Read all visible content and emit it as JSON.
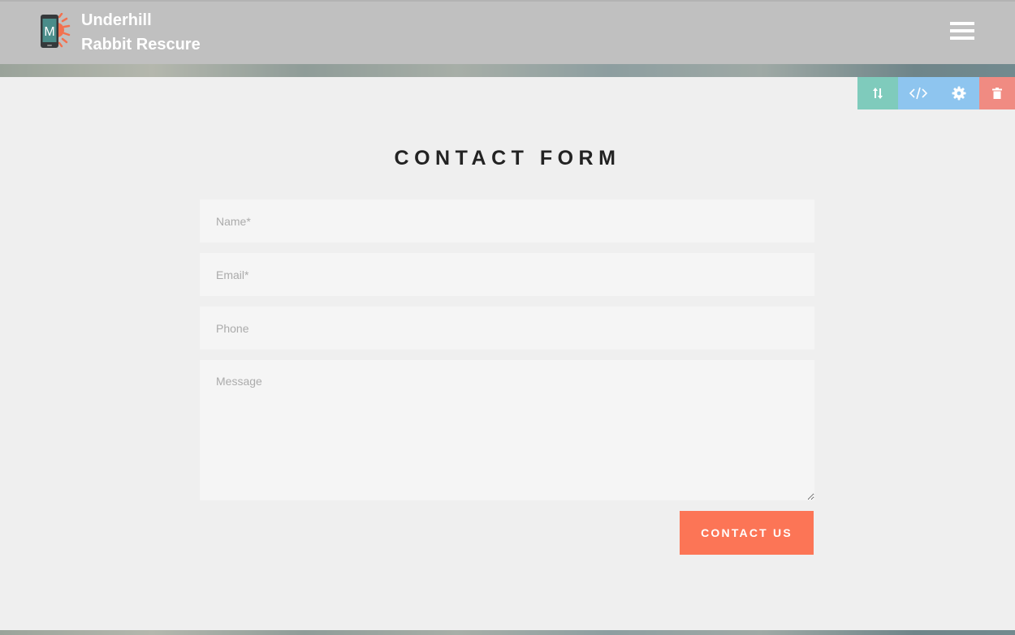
{
  "header": {
    "logo_letter": "M",
    "brand_line1": "Underhill",
    "brand_line2": "Rabbit Rescure",
    "menu_icon": "hamburger-menu-icon"
  },
  "toolbar": {
    "icons": [
      "sort-arrows-icon",
      "code-icon",
      "gear-icon",
      "trash-icon"
    ],
    "colors": {
      "move": "#7fcbbc",
      "code": "#8ec5ef",
      "settings": "#8ec5ef",
      "delete": "#f08b82"
    }
  },
  "form": {
    "title": "CONTACT FORM",
    "name_placeholder": "Name*",
    "email_placeholder": "Email*",
    "phone_placeholder": "Phone",
    "message_placeholder": "Message",
    "submit_label": "CONTACT US"
  },
  "colors": {
    "header_bg": "#c0c0c0",
    "section_bg": "#efefef",
    "field_bg": "#f5f5f5",
    "accent": "#fc7556"
  }
}
